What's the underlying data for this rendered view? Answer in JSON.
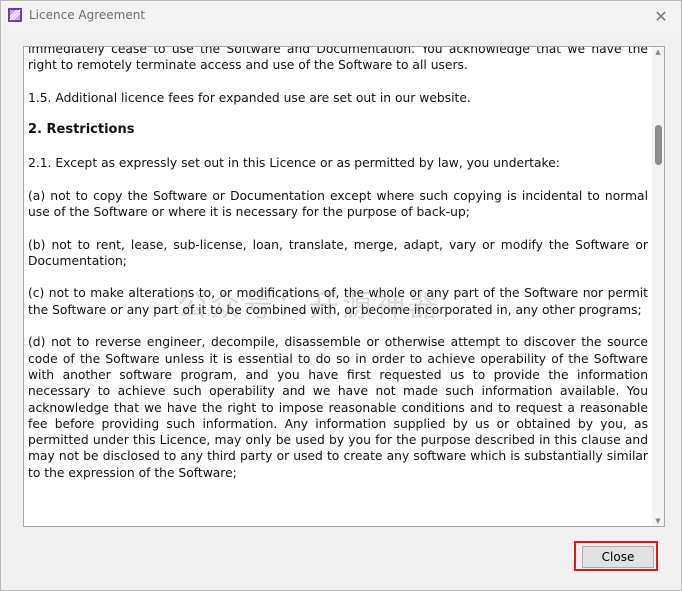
{
  "window": {
    "title": "Licence Agreement",
    "close_glyph": "✕"
  },
  "licence_text": {
    "paragraphs": [
      {
        "text": "immediately cease to use the Software and Documentation. You acknowledge that we have the right to remotely terminate access and use of the Software to all users.",
        "heading": false
      },
      {
        "text": "1.5. Additional licence fees for expanded use are set out in our website.",
        "heading": false
      },
      {
        "text": "2. Restrictions",
        "heading": true
      },
      {
        "text": "2.1. Except as expressly set out in this Licence or as permitted by law, you undertake:",
        "heading": false
      },
      {
        "text": "(a) not to copy the Software or Documentation except where such copying is incidental to normal use of the Software or where it is necessary for the purpose of back-up;",
        "heading": false
      },
      {
        "text": "(b) not to rent, lease, sub-license, loan, translate, merge, adapt, vary or modify the Software or Documentation;",
        "heading": false
      },
      {
        "text": "(c) not to make alterations to, or modifications of, the whole or any part of the Software nor permit the Software or any part of it to be combined with, or become incorporated in, any other programs;",
        "heading": false
      },
      {
        "text": "(d) not to reverse engineer, decompile, disassemble or otherwise attempt to discover the source code of the Software unless it is essential to do so in order to achieve operability of the Software with another software program, and you have first requested us to provide the information necessary to achieve such operability and we have not made such information available. You acknowledge that we have the right to impose reasonable conditions and to request a reasonable fee before providing such information. Any information supplied by us or obtained by you, as permitted under this Licence, may only be used by you for the purpose described in this clause and may not be disclosed to any third party or used to create any software which is substantially similar to the expression of the Software;",
        "heading": false
      }
    ]
  },
  "watermark": {
    "text": "公众号：开源神器"
  },
  "buttons": {
    "close_label": "Close"
  },
  "colors": {
    "highlight": "#e0161b",
    "window_bg": "#f0f0f0",
    "text_bg": "#ffffff"
  }
}
